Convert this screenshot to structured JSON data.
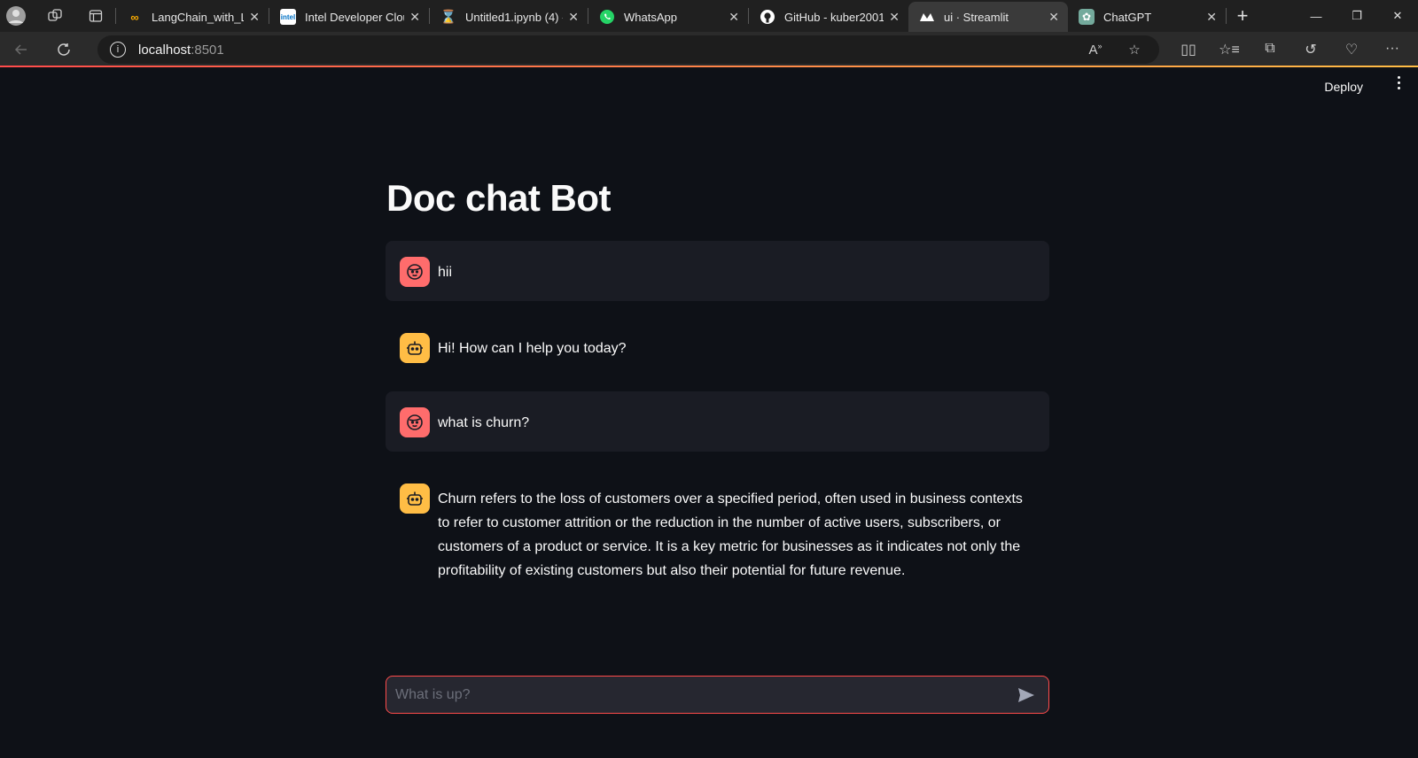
{
  "browser": {
    "tabs": [
      {
        "title": "LangChain_with_Llam",
        "favicon": "colab-icon",
        "color": "#f9ab00"
      },
      {
        "title": "Intel Developer Clou",
        "favicon": "intel-icon",
        "color": "#0071c5"
      },
      {
        "title": "Untitled1.ipynb (4) -",
        "favicon": "hourglass-icon",
        "color": "#f28c28"
      },
      {
        "title": "WhatsApp",
        "favicon": "whatsapp-icon",
        "color": "#25d366"
      },
      {
        "title": "GitHub - kuber2001",
        "favicon": "github-icon",
        "color": "#ffffff"
      },
      {
        "title": "ui · Streamlit",
        "favicon": "streamlit-icon",
        "color": "#ff4b4b",
        "active": true
      },
      {
        "title": "ChatGPT",
        "favicon": "chatgpt-icon",
        "color": "#74aa9c"
      }
    ],
    "address": {
      "host": "localhost",
      "port": ":8501"
    }
  },
  "app": {
    "deploy_label": "Deploy",
    "title": "Doc chat Bot",
    "messages": [
      {
        "role": "user",
        "text": "hii"
      },
      {
        "role": "assistant",
        "text": "Hi! How can I help you today?"
      },
      {
        "role": "user",
        "text": "what is churn?"
      },
      {
        "role": "assistant",
        "text": "Churn refers to the loss of customers over a specified period, often used in business contexts to refer to customer attrition or the reduction in the number of active users, subscribers, or customers of a product or service. It is a key metric for businesses as it indicates not only the profitability of existing customers but also their potential for future revenue."
      }
    ],
    "chat_input": {
      "placeholder": "What is up?",
      "value": ""
    }
  },
  "colors": {
    "accent": "#ff4b4b",
    "user_avatar": "#ff6c6c",
    "bot_avatar": "#ffbd45",
    "background": "#0e1117"
  }
}
